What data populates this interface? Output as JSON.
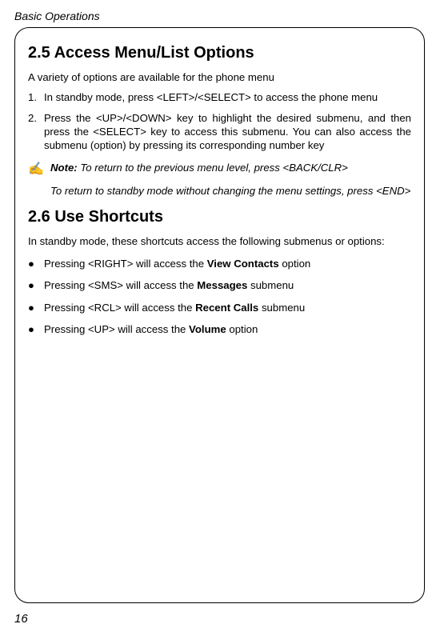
{
  "header": "Basic Operations",
  "section1": {
    "heading": "2.5 Access Menu/List Options",
    "intro": "A variety of options are available for the phone menu",
    "steps": [
      {
        "num": "1.",
        "text": "In standby mode, press <LEFT>/<SELECT> to access the phone menu"
      },
      {
        "num": "2.",
        "text": "Press the <UP>/<DOWN> key to highlight the desired submenu, and then press the <SELECT> key to access this submenu. You can also access the submenu (option) by pressing its corresponding number key"
      }
    ],
    "note": {
      "icon": "✍",
      "label": "Note:",
      "line1": " To return to the previous menu level, press <BACK/CLR>",
      "line2": "To return to standby mode without changing the menu settings, press <END>"
    }
  },
  "section2": {
    "heading": "2.6 Use Shortcuts",
    "intro": "In standby mode, these shortcuts access the following submenus or options:",
    "bullets": [
      {
        "pre": "Pressing <RIGHT> will access the ",
        "bold": "View Contacts",
        "post": " option"
      },
      {
        "pre": "Pressing <SMS> will access the ",
        "bold": "Messages",
        "post": " submenu"
      },
      {
        "pre": "Pressing <RCL> will access the ",
        "bold": "Recent Calls",
        "post": " submenu"
      },
      {
        "pre": "Pressing <UP> will access the ",
        "bold": "Volume",
        "post": " option"
      }
    ],
    "bullet_char": "●"
  },
  "pagenum": "16"
}
